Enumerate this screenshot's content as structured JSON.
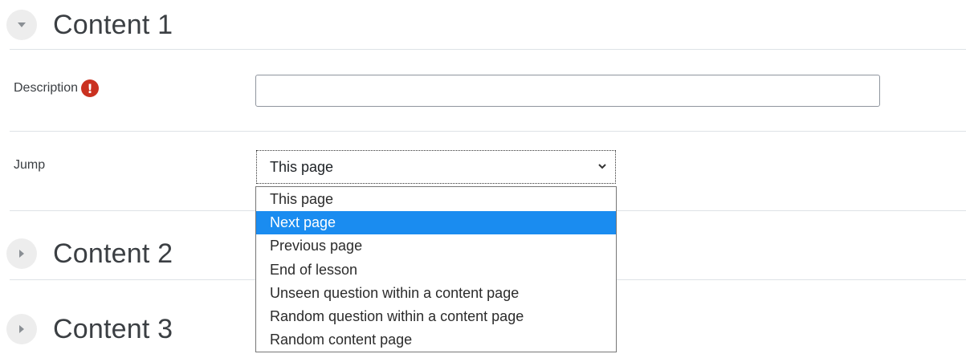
{
  "sections": [
    {
      "title": "Content 1",
      "expanded": true
    },
    {
      "title": "Content 2",
      "expanded": false
    },
    {
      "title": "Content 3",
      "expanded": false
    }
  ],
  "description": {
    "label": "Description",
    "required_icon": "exclamation-circle-icon",
    "value": ""
  },
  "jump": {
    "label": "Jump",
    "selected": "This page",
    "highlighted": "Next page",
    "options": [
      "This page",
      "Next page",
      "Previous page",
      "End of lesson",
      "Unseen question within a content page",
      "Random question within a content page",
      "Random content page"
    ]
  },
  "colors": {
    "required": "#ca3120",
    "highlight": "#1a8cf0",
    "toggle_bg": "#ededed"
  }
}
